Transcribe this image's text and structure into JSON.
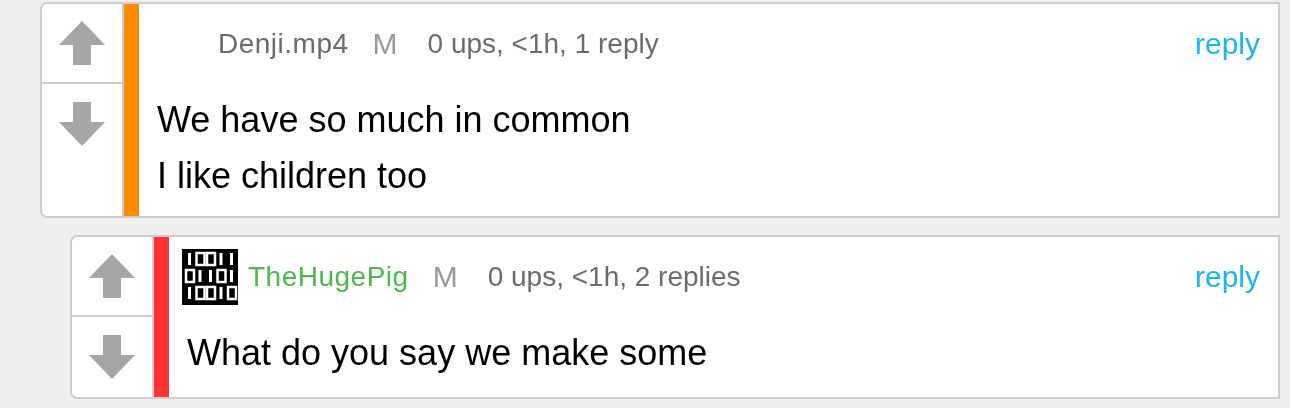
{
  "comments": [
    {
      "avatar": false,
      "username": {
        "text": "Denji.mp4",
        "color": "#6b6b6b"
      },
      "badge": "M",
      "meta": "0 ups, <1h, 1 reply",
      "reply": "reply",
      "color": "#ff8c00",
      "body": [
        "We have so much in common",
        "I like children too"
      ],
      "children": [
        {
          "avatar": true,
          "username": {
            "text": "TheHugePig",
            "color": "#4cb84c"
          },
          "badge": "M",
          "meta": "0 ups, <1h, 2 replies",
          "reply": "reply",
          "color": "#ff3333",
          "body": [
            "What do you say we make some"
          ]
        }
      ]
    }
  ]
}
